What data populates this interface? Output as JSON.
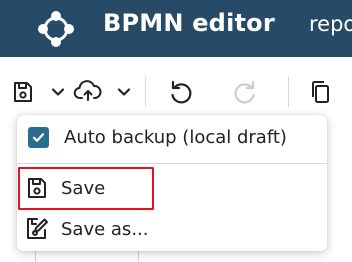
{
  "header": {
    "title": "BPMN editor",
    "nav_link": "repo",
    "logo_icon": "hub-logo-icon",
    "background": "#274b67"
  },
  "toolbar": {
    "buttons": [
      {
        "name": "save-icon",
        "enabled": true
      },
      {
        "name": "chevron-down-icon",
        "enabled": true
      },
      {
        "name": "cloud-upload-icon",
        "enabled": true
      },
      {
        "name": "chevron-down-icon",
        "enabled": true
      },
      {
        "name": "undo-icon",
        "enabled": true
      },
      {
        "name": "redo-icon",
        "enabled": false
      },
      {
        "name": "copy-icon",
        "enabled": true
      }
    ]
  },
  "save_menu": {
    "auto_backup": {
      "label": "Auto backup (local draft)",
      "checked": true
    },
    "save": {
      "label": "Save",
      "icon": "save-icon",
      "highlighted": true
    },
    "save_as": {
      "label": "Save as...",
      "icon": "save-as-edit-icon"
    }
  },
  "colors": {
    "accent": "#2b6c8f",
    "highlight": "#e0141e"
  }
}
